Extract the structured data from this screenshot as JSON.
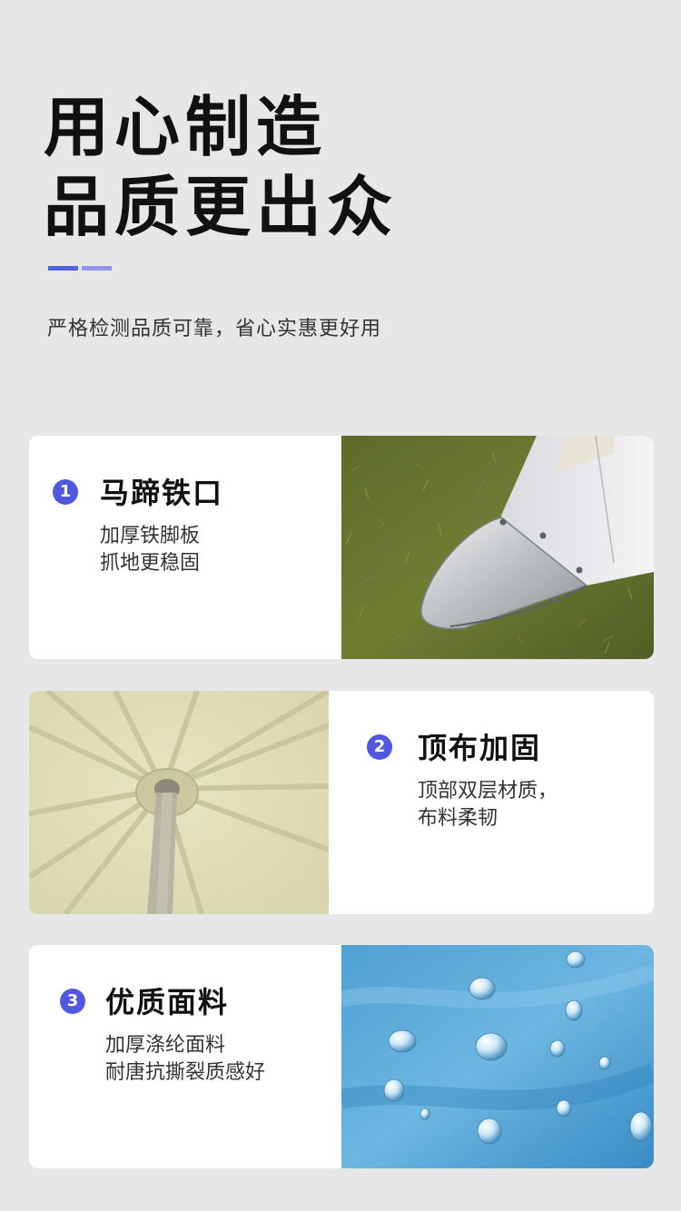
{
  "header": {
    "title_line1": "用心制造",
    "title_line2": "品质更出众",
    "subtitle": "严格检测品质可靠，省心实惠更好用"
  },
  "features": [
    {
      "number": "1",
      "title": "马蹄铁口",
      "desc_line1": "加厚铁脚板",
      "desc_line2": "抓地更稳固",
      "image": "tent-leg-steel-foot-on-grass"
    },
    {
      "number": "2",
      "title": "顶布加固",
      "desc_line1": "顶部双层材质，",
      "desc_line2": "布料柔韧",
      "image": "canopy-top-interior-reinforced"
    },
    {
      "number": "3",
      "title": "优质面料",
      "desc_line1": "加厚涤纶面料",
      "desc_line2": "耐唐抗撕裂质感好",
      "image": "blue-fabric-water-droplets"
    }
  ],
  "colors": {
    "background": "#e7e7e8",
    "accent": "#5058df",
    "accent_light": "#8f95ec",
    "card": "#ffffff"
  }
}
